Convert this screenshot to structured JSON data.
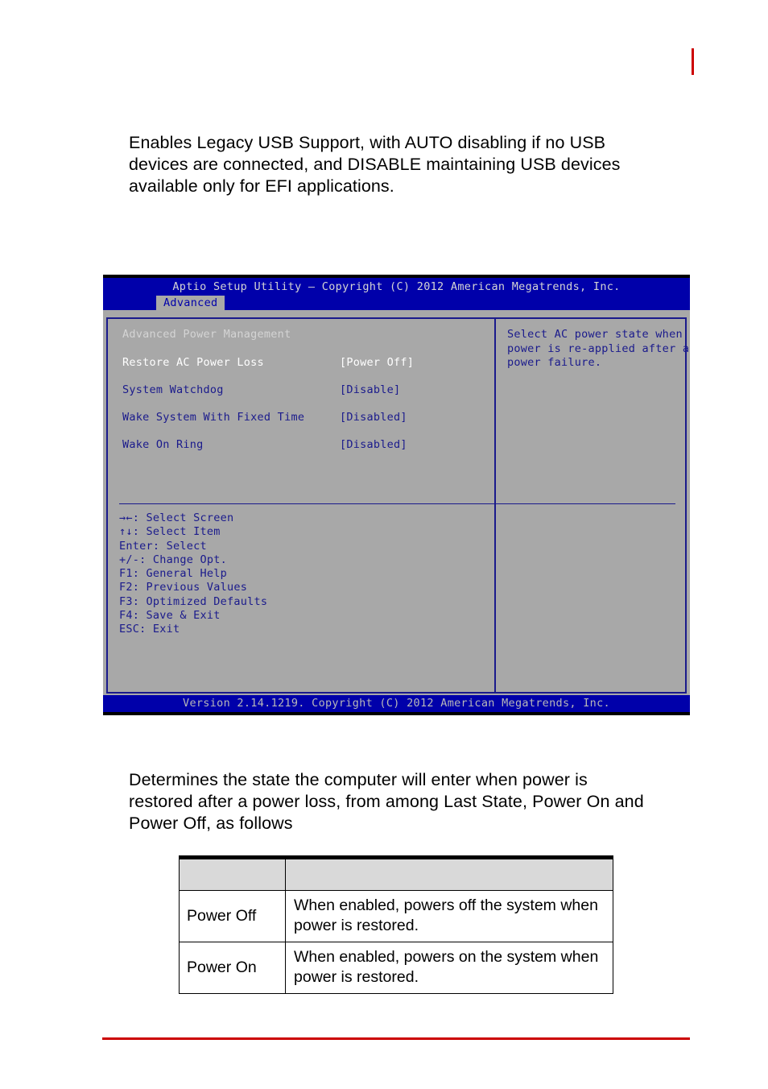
{
  "page": {
    "marker_color": "#cc0000",
    "rule_color": "#cc0000"
  },
  "paragraphs": {
    "top": "Enables Legacy USB Support, with AUTO disabling if no USB devices are connected, and DISABLE maintaining USB devices available only for EFI applications.",
    "top_line1": "Enables Legacy USB Support, with AUTO disabling if no USB",
    "top_line2": "devices are connected, and DISABLE maintaining USB devices",
    "top_line3": "available only for EFI applications.",
    "middle": "Determines the state the computer will enter when power is restored after a power loss, from among Last State, Power On and Power Off, as follows",
    "mid_line1": "Determines the state the computer will enter when power is",
    "mid_line2": "restored after a power loss, from among Last State, Power On and",
    "mid_line3": "Power Off, as follows"
  },
  "bios": {
    "title": "Aptio Setup Utility – Copyright (C) 2012 American Megatrends, Inc.",
    "tabs": [
      {
        "label": "Advanced",
        "active": true
      }
    ],
    "section_heading": "Advanced Power Management",
    "settings": [
      {
        "label": "Restore AC Power Loss",
        "value": "[Power Off]",
        "state": "selected"
      },
      {
        "label": "System Watchdog",
        "value": "[Disable]",
        "state": "option"
      },
      {
        "label": "Wake System With Fixed Time",
        "value": "[Disabled]",
        "state": "option"
      },
      {
        "label": "Wake On Ring",
        "value": "[Disabled]",
        "state": "option"
      }
    ],
    "help": {
      "lines": [
        "Select AC power state when",
        "power is re-applied after a",
        "power failure."
      ]
    },
    "nav_keys": [
      "→←: Select Screen",
      "↑↓: Select Item",
      "Enter: Select",
      "+/-: Change Opt.",
      "F1: General Help",
      "F2: Previous Values",
      "F3: Optimized Defaults",
      "F4: Save & Exit",
      "ESC: Exit"
    ],
    "footer": "Version 2.14.1219. Copyright (C) 2012 American Megatrends, Inc.",
    "colors": {
      "bar": "#0000aa",
      "background": "#a8a8a8",
      "option_text": "#1a1a8c",
      "selected_text": "#ffffff",
      "border": "#000000"
    }
  },
  "table": {
    "header": {
      "col1": "",
      "col2": ""
    },
    "rows": [
      {
        "option": "Power Off",
        "description": "When enabled, powers off the system when power is restored."
      },
      {
        "option": "Power On",
        "description": "When enabled, powers on the system when power is restored."
      }
    ]
  }
}
